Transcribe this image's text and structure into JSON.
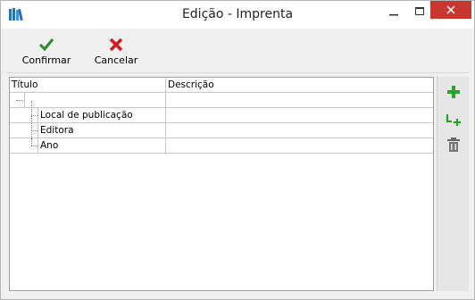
{
  "window": {
    "title": "Edição - Imprenta"
  },
  "toolbar": {
    "confirm_label": "Confirmar",
    "cancel_label": "Cancelar"
  },
  "grid": {
    "columns": [
      "Título",
      "Descrição"
    ],
    "rows": [
      {
        "title": "",
        "description": ""
      },
      {
        "title": "Local de publicação",
        "description": ""
      },
      {
        "title": "Editora",
        "description": ""
      },
      {
        "title": "Ano",
        "description": ""
      }
    ]
  },
  "colors": {
    "confirm": "#2e8b2e",
    "cancel": "#d7191f",
    "add": "#2aa32a",
    "close_button": "#c7372f"
  },
  "icons": {
    "app": "books-icon",
    "confirm": "checkmark-icon",
    "cancel": "x-icon",
    "add": "plus-icon",
    "add_child": "add-child-icon",
    "delete": "trash-icon"
  }
}
